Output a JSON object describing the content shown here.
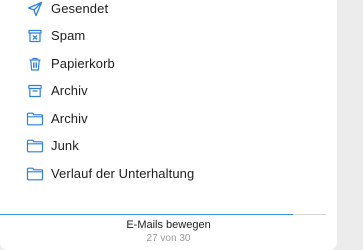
{
  "colors": {
    "accent": "#3a8ee6",
    "text": "#1d1d1f",
    "subtext": "#9a9a9a",
    "background": "#ffffff"
  },
  "folders": [
    {
      "label": "Gesendet",
      "icon": "paper-plane-icon"
    },
    {
      "label": "Spam",
      "icon": "junk-tray-icon"
    },
    {
      "label": "Papierkorb",
      "icon": "trash-icon"
    },
    {
      "label": "Archiv",
      "icon": "archive-box-icon"
    },
    {
      "label": "Archiv",
      "icon": "folder-icon"
    },
    {
      "label": "Junk",
      "icon": "folder-icon"
    },
    {
      "label": "Verlauf der Unterhaltung",
      "icon": "folder-icon"
    }
  ],
  "status": {
    "title": "E-Mails bewegen",
    "count_text": "27 von 30",
    "progress_fraction": 0.9
  }
}
